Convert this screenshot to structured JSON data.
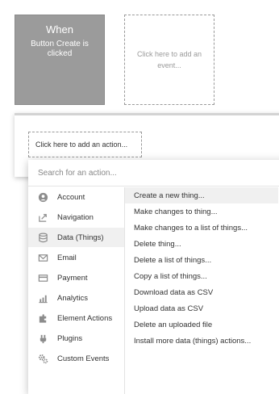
{
  "event": {
    "title": "When",
    "subtitle": "Button Create is clicked"
  },
  "event_placeholder": "Click here to add an event...",
  "action_placeholder": "Click here to add an action...",
  "dropdown": {
    "search_placeholder": "Search for an action...",
    "categories": [
      {
        "label": "Account",
        "icon": "account-icon"
      },
      {
        "label": "Navigation",
        "icon": "navigation-icon"
      },
      {
        "label": "Data (Things)",
        "icon": "database-icon",
        "selected": true
      },
      {
        "label": "Email",
        "icon": "email-icon"
      },
      {
        "label": "Payment",
        "icon": "payment-icon"
      },
      {
        "label": "Analytics",
        "icon": "analytics-icon"
      },
      {
        "label": "Element Actions",
        "icon": "element-actions-icon"
      },
      {
        "label": "Plugins",
        "icon": "plugins-icon"
      },
      {
        "label": "Custom Events",
        "icon": "custom-events-icon"
      }
    ],
    "actions": [
      {
        "label": "Create a new thing...",
        "selected": true
      },
      {
        "label": "Make changes to thing..."
      },
      {
        "label": "Make changes to a list of things..."
      },
      {
        "label": "Delete thing..."
      },
      {
        "label": "Delete a list of things..."
      },
      {
        "label": "Copy a list of things..."
      },
      {
        "label": "Download data as CSV"
      },
      {
        "label": "Upload data as CSV"
      },
      {
        "label": "Delete an uploaded file"
      },
      {
        "label": "Install more data (things) actions..."
      }
    ]
  }
}
